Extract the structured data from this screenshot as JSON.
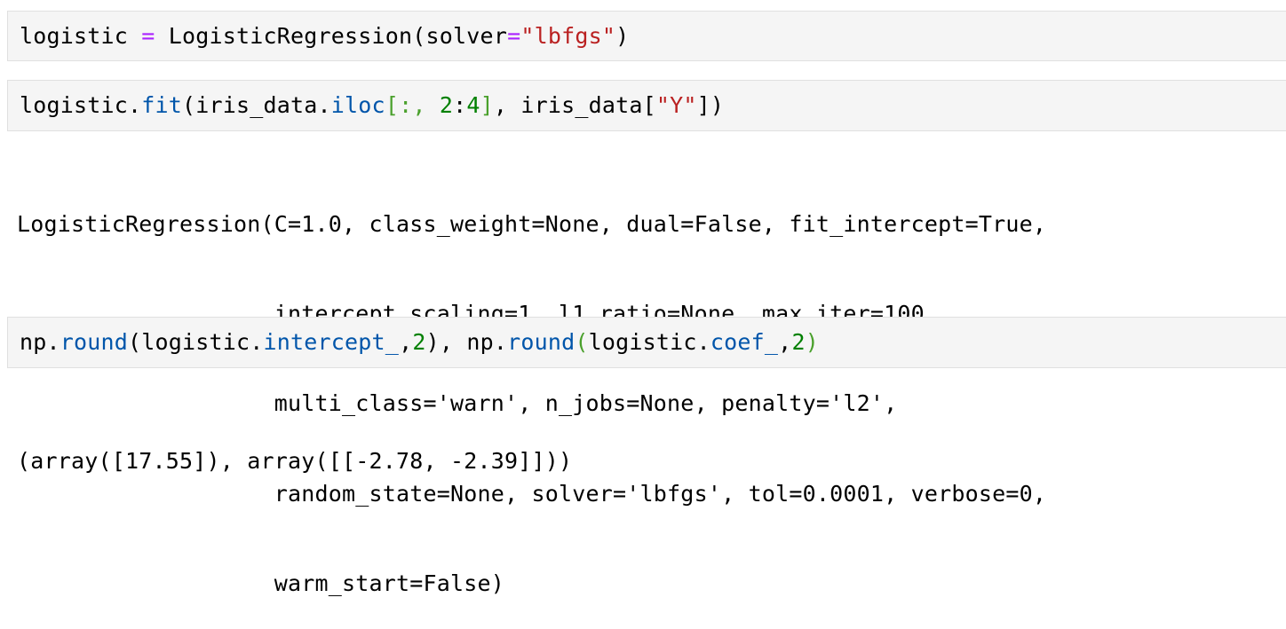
{
  "cells": [
    {
      "input": {
        "t1": "logistic ",
        "t2": "=",
        "t3": " LogisticRegression(solver",
        "t4": "=",
        "t5": "\"lbfgs\"",
        "t6": ")"
      }
    },
    {
      "input": {
        "t1": "logistic.",
        "t2": "fit",
        "t3": "(iris_data.",
        "t4": "iloc",
        "t5": "[:, ",
        "t6": "2",
        "t7": ":",
        "t8": "4",
        "t9": "]",
        "t10": ", iris_data[",
        "t11": "\"Y\"",
        "t12": "])"
      },
      "output": [
        "LogisticRegression(C=1.0, class_weight=None, dual=False, fit_intercept=True,",
        "                   intercept_scaling=1, l1_ratio=None, max_iter=100,",
        "                   multi_class='warn', n_jobs=None, penalty='l2',",
        "                   random_state=None, solver='lbfgs', tol=0.0001, verbose=0,",
        "                   warm_start=False)"
      ]
    },
    {
      "input": {
        "t1": "np.",
        "t2": "round",
        "t3": "(logistic.",
        "t4": "intercept_",
        "t5": ",",
        "t6": "2",
        "t7": "), np.",
        "t8": "round",
        "t9": "(",
        "t10": "logistic.",
        "t11": "coef_",
        "t12": ",",
        "t13": "2",
        "t14": ")"
      },
      "output": [
        "(array([17.55]), array([[-2.78, -2.39]]))"
      ]
    }
  ]
}
